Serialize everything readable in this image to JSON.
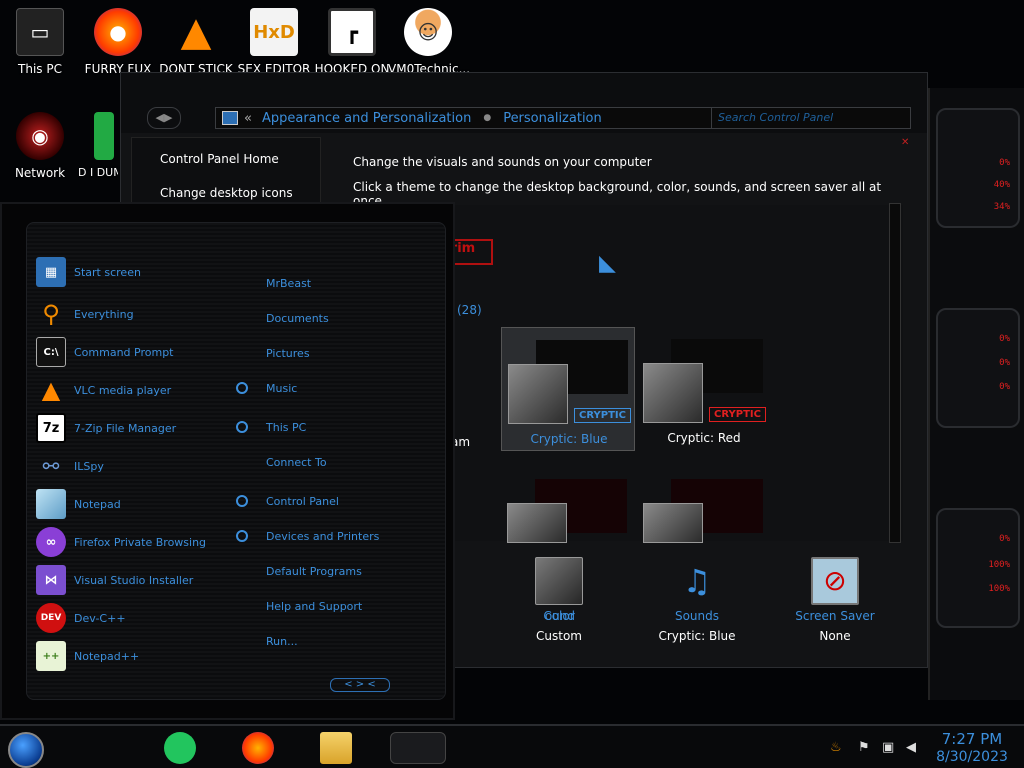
{
  "desktop": {
    "icons": [
      {
        "label": "This PC",
        "icon": "computer-icon"
      },
      {
        "label": "FURRY FUX",
        "icon": "firefox-icon"
      },
      {
        "label": "DONT STICK",
        "icon": "vlc-cone-icon"
      },
      {
        "label": "SEX EDITOR",
        "icon": "hxd-editor-icon"
      },
      {
        "label": "HOOKED ON",
        "icon": "maze-game-icon"
      },
      {
        "label": "VM0Technic...",
        "icon": "doctor-avatar-icon"
      },
      {
        "label": "Network",
        "icon": "network-icon"
      },
      {
        "label": "D I DUM",
        "icon": "app-icon"
      }
    ]
  },
  "control_panel": {
    "address_prefix": "«",
    "breadcrumb": [
      "Appearance and Personalization",
      "Personalization"
    ],
    "search_placeholder": "Search Control Panel",
    "nav_links": [
      "Control Panel Home",
      "Change desktop icons"
    ],
    "heading": "Change the visuals and sounds on your computer",
    "subheading": "Click a theme to change the desktop background, color, sounds, and screen saver all at once.",
    "theme_count": "(28)",
    "partial_labels": {
      "rim": "rim",
      "am": "am"
    },
    "themes": [
      {
        "name": "Cryptic: Blue",
        "badge": "CRYPTIC",
        "selected": true
      },
      {
        "name": "Cryptic: Red",
        "badge": "CRYPTIC",
        "selected": false
      }
    ],
    "bottom": [
      {
        "label": "ound",
        "value": ""
      },
      {
        "label": "Color",
        "value": "Custom"
      },
      {
        "label": "Sounds",
        "value": "Cryptic: Blue"
      },
      {
        "label": "Screen Saver",
        "value": "None"
      }
    ]
  },
  "start_menu": {
    "left_items": [
      {
        "label": "Start screen",
        "icon": "start-screen-icon",
        "color": "#2d6fb4"
      },
      {
        "label": "Everything",
        "icon": "search-magnifier-icon",
        "color": "#f08a00"
      },
      {
        "label": "Command Prompt",
        "icon": "terminal-icon",
        "color": "#222222"
      },
      {
        "label": "VLC media player",
        "icon": "vlc-cone-icon",
        "color": "#ff8800"
      },
      {
        "label": "7-Zip File Manager",
        "icon": "7zip-icon",
        "color": "#ffffff"
      },
      {
        "label": "ILSpy",
        "icon": "ilspy-icon",
        "color": "#6c9ad6"
      },
      {
        "label": "Notepad",
        "icon": "notepad-icon",
        "color": "#6aaed6"
      },
      {
        "label": "Firefox Private Browsing",
        "icon": "firefox-private-icon",
        "color": "#8a3fd6"
      },
      {
        "label": "Visual Studio Installer",
        "icon": "visual-studio-icon",
        "color": "#7b4fd0"
      },
      {
        "label": "Dev-C++",
        "icon": "dev-cpp-icon",
        "color": "#d01010"
      },
      {
        "label": "Notepad++",
        "icon": "notepad-plus-icon",
        "color": "#8cbf3c"
      }
    ],
    "right_items": [
      {
        "label": "MrBeast",
        "pinned": false
      },
      {
        "label": "Documents",
        "pinned": false
      },
      {
        "label": "Pictures",
        "pinned": false
      },
      {
        "label": "Music",
        "pinned": true
      },
      {
        "label": "This PC",
        "pinned": true
      },
      {
        "label": "Connect To",
        "pinned": false
      },
      {
        "label": "Control Panel",
        "pinned": true
      },
      {
        "label": "Devices and Printers",
        "pinned": true
      },
      {
        "label": "Default Programs",
        "pinned": false
      },
      {
        "label": "Help and Support",
        "pinned": false
      },
      {
        "label": "Run...",
        "pinned": false
      }
    ],
    "arrows": "< > <"
  },
  "right_panel": {
    "readouts": [
      "0%",
      "40%",
      "34%",
      "0%",
      "0%",
      "0%",
      "0%",
      "100%",
      "100%"
    ]
  },
  "taskbar": {
    "time": "7:27 PM",
    "date": "8/30/2023"
  },
  "colors": {
    "accent": "#3c8fdc",
    "text": "#ffffff",
    "bg": "#030406",
    "red": "#e02020"
  }
}
